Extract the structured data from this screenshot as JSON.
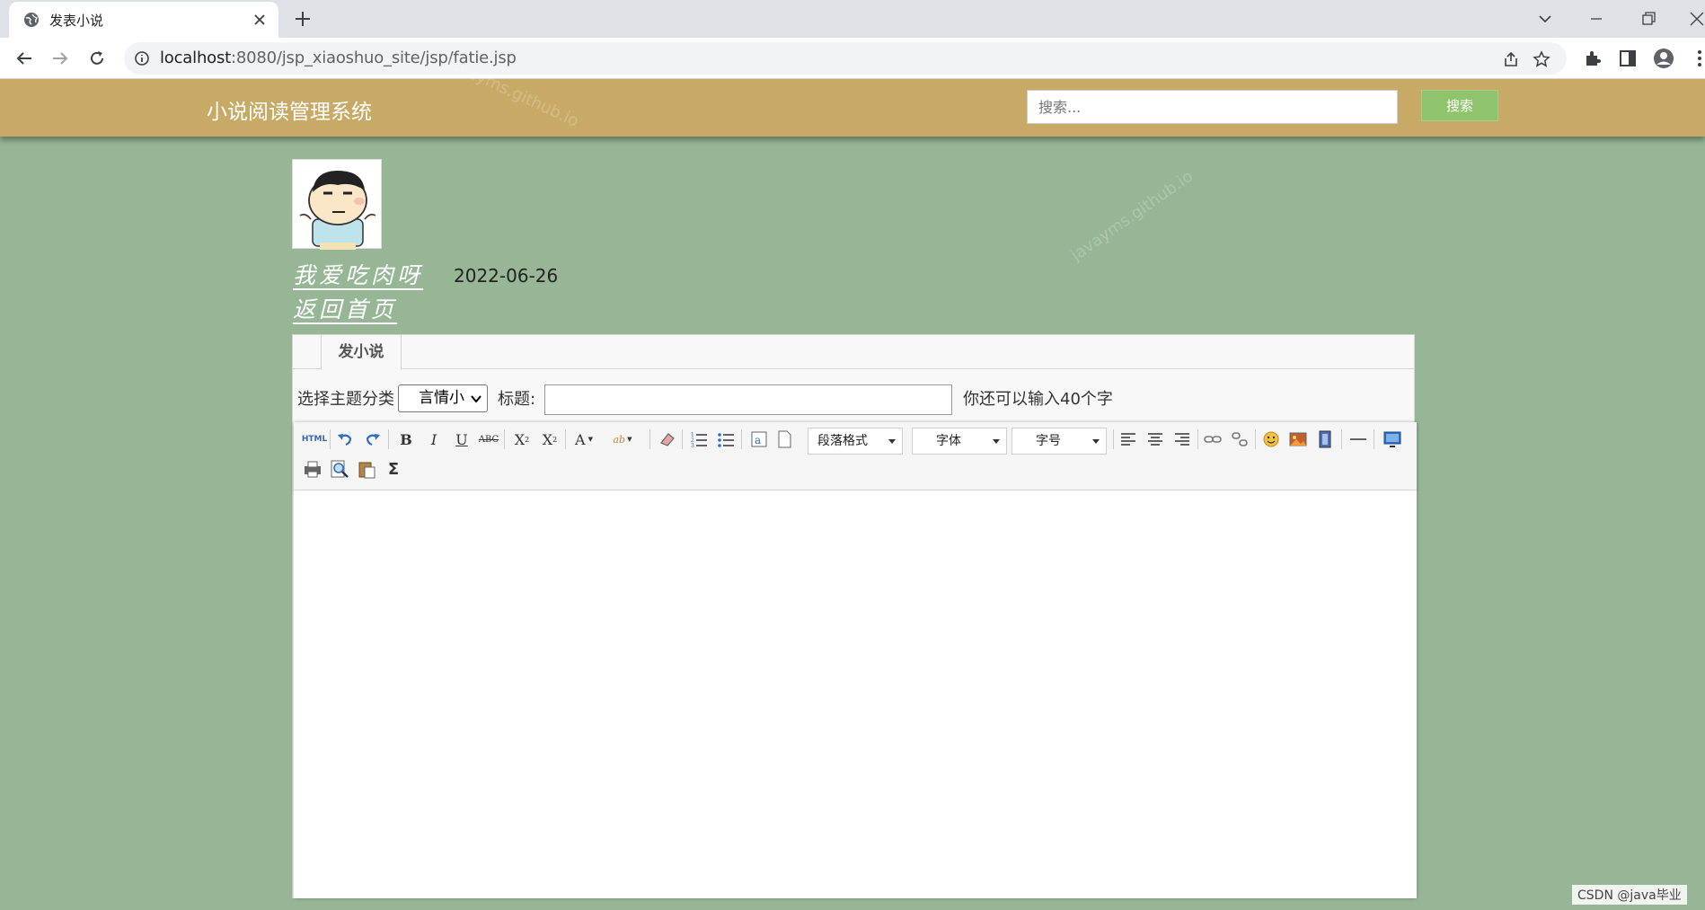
{
  "browser": {
    "tab_title": "发表小说",
    "url_host": "localhost",
    "url_path": ":8080/jsp_xiaoshuo_site/jsp/fatie.jsp"
  },
  "header": {
    "site_title": "小说阅读管理系统",
    "search_placeholder": "搜索...",
    "search_button": "搜索"
  },
  "user": {
    "name": "我爱吃肉呀",
    "date": "2022-06-26",
    "back_link": "返回首页"
  },
  "panel": {
    "tab_label": "发小说",
    "theme_label": "选择主题分类",
    "theme_selected": "言情小",
    "title_label": "标题:",
    "title_value": "",
    "char_hint": "你还可以输入40个字"
  },
  "editor": {
    "paragraph_combo": "段落格式",
    "font_combo": "字体",
    "size_combo": "字号",
    "html_button": "HTML",
    "sigma_button": "Σ"
  },
  "watermark": "javayms.github.io",
  "footer_badge": "CSDN @java毕业"
}
